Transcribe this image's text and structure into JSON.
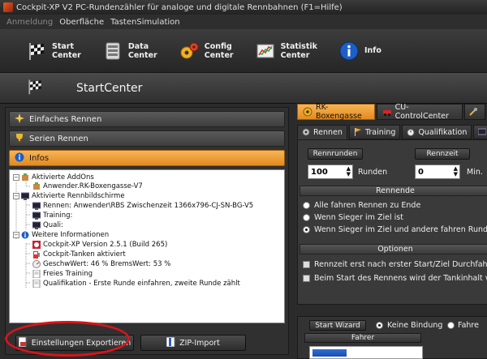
{
  "window": {
    "title": "Cockpit-XP V2 PC-Rundenzähler für analoge und digitale Rennbahnen (F1=Hilfe)"
  },
  "menu": [
    {
      "label": "Anmeldung",
      "disabled": true
    },
    {
      "label": "Oberfläche",
      "disabled": false
    },
    {
      "label": "TastenSimulation",
      "disabled": false
    }
  ],
  "toolbar": [
    {
      "line1": "Start",
      "line2": "Center",
      "icon": "checkered-flag-icon"
    },
    {
      "line1": "Data",
      "line2": "Center",
      "icon": "database-icon"
    },
    {
      "line1": "Config",
      "line2": "Center",
      "icon": "gears-icon"
    },
    {
      "line1": "Statistik",
      "line2": "Center",
      "icon": "chart-icon"
    },
    {
      "line1": "Info",
      "line2": "",
      "icon": "info-icon"
    }
  ],
  "header": {
    "title": "StartCenter"
  },
  "left": {
    "accordion": [
      {
        "label": "Einfaches Rennen"
      },
      {
        "label": "Serien Rennen"
      },
      {
        "label": "Infos"
      }
    ],
    "tree": [
      {
        "text": "Aktivierte AddOns"
      },
      {
        "text": "Anwender.RK-Boxengasse-V7"
      },
      {
        "text": "Aktivierte Rennbildschirme"
      },
      {
        "text": "Rennen: Anwender\\RBS Zwischenzeit 1366x796-CJ-SN-BG-V5"
      },
      {
        "text": "Training:"
      },
      {
        "text": "Quali:"
      },
      {
        "text": "Weitere Informationen"
      },
      {
        "text": "Cockpit-XP Version 2.5.1 (Build 265)"
      },
      {
        "text": "Cockpit-Tanken aktiviert"
      },
      {
        "text": "GeschwWert: 46 % BremsWert: 53 %"
      },
      {
        "text": "Freies Training"
      },
      {
        "text": "Qualifikation - Erste Runde einfahren, zweite Runde zählt"
      }
    ],
    "export_button": "Einstellungen Exportieren",
    "zip_button": "ZIP-Import"
  },
  "right": {
    "tabs": [
      {
        "label": "RK-Boxengasse"
      },
      {
        "label": "CU-ControlCenter"
      }
    ],
    "subtabs": [
      {
        "label": "Rennen"
      },
      {
        "label": "Training"
      },
      {
        "label": "Qualifikation"
      },
      {
        "label": "R"
      }
    ],
    "rennrunden_label": "Rennrunden",
    "rennzeit_label": "Rennzeit",
    "rounds_value": "100",
    "runden_unit": "Runden",
    "time_value": "0",
    "min_unit": "Min.",
    "rennende_label": "Rennende",
    "end_options": [
      {
        "label": "Alle fahren Rennen zu Ende",
        "selected": false
      },
      {
        "label": "Wenn Sieger im Ziel ist",
        "selected": false
      },
      {
        "label": "Wenn Sieger im Ziel und andere fahren Runde",
        "selected": true
      }
    ],
    "optionen_label": "Optionen",
    "options": [
      {
        "label": "Rennzeit erst nach erster Start/Ziel Durchfahrt"
      },
      {
        "label": "Beim Start des Rennens wird der Tankinhalt ve"
      }
    ],
    "start_wizard": "Start Wizard",
    "keine_bindung": "Keine Bindung",
    "fahrer_radio": "Fahre",
    "fahrer_header": "Fahrer"
  },
  "colors": {
    "accent": "#f0a040",
    "annotation": "#d8141a"
  }
}
